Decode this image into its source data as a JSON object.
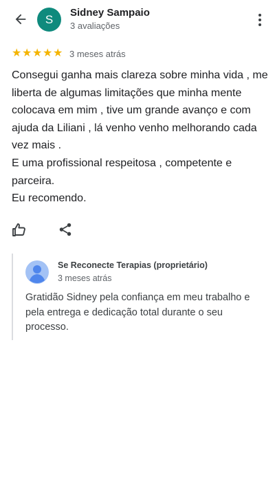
{
  "header": {
    "back_icon": "arrow-left-icon",
    "avatar_letter": "S",
    "avatar_color": "#0f8a7d",
    "reviewer_name": "Sidney Sampaio",
    "review_count": "3 avaliações",
    "menu_icon": "more-vert-icon"
  },
  "review": {
    "rating": 5,
    "max_rating": 5,
    "star_color": "#f4b400",
    "time": "3 meses atrás",
    "text": "Consegui ganha mais clareza sobre minha vida , me liberta de algumas limitações que minha mente colocava em mim , tive um grande avanço e com ajuda da Liliani , lá venho venho melhorando cada vez mais .\nE uma profissional respeitosa , competente e parceira.\nEu recomendo."
  },
  "actions": {
    "like_icon": "thumb-up-icon",
    "share_icon": "share-icon"
  },
  "owner_response": {
    "name": "Se Reconecte Terapias (proprietário)",
    "time": "3 meses atrás",
    "text": "Gratidão Sidney pela confiança em meu trabalho e pela entrega e dedicação total durante o seu processo.",
    "avatar_icon": "default-profile-icon"
  }
}
